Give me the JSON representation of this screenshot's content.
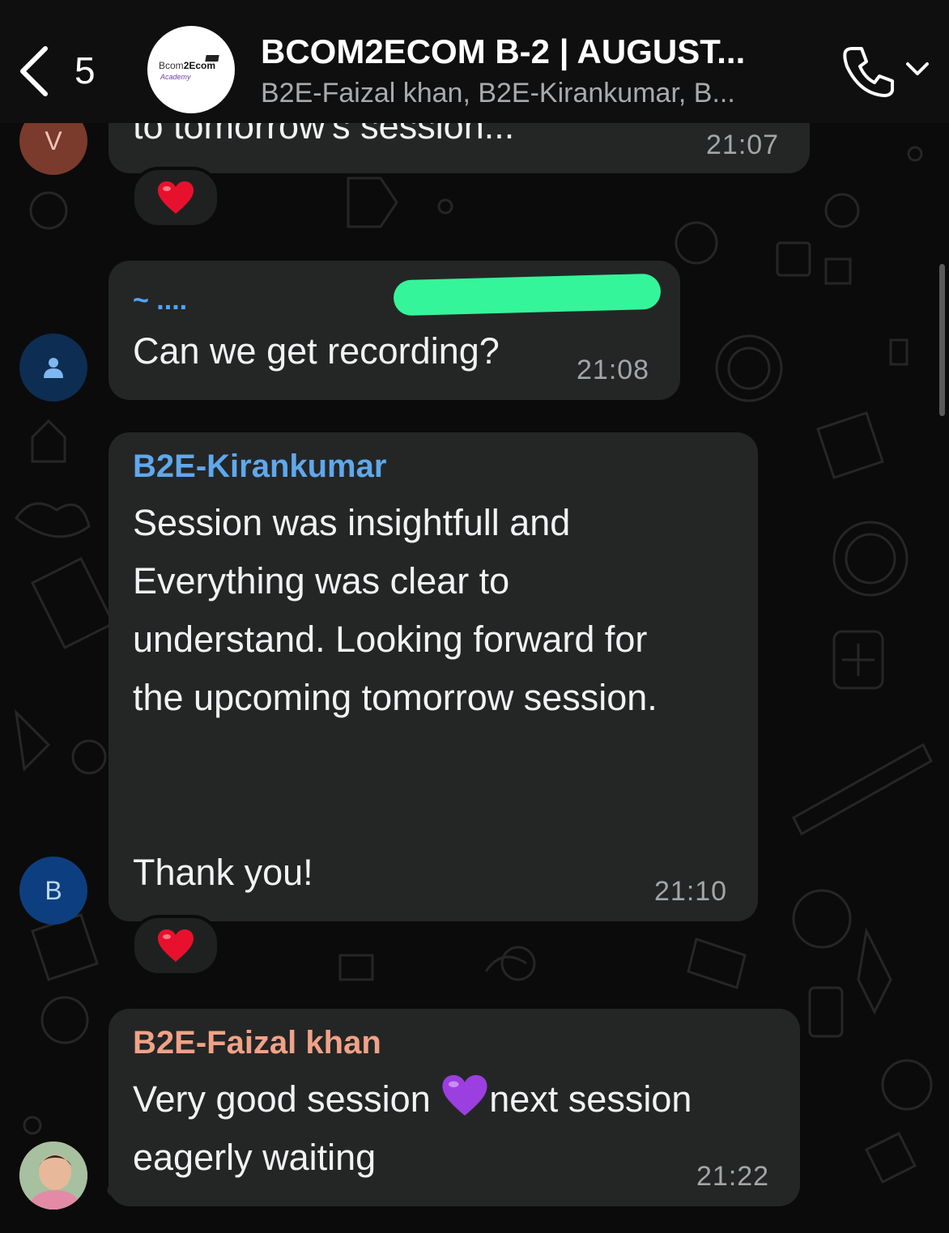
{
  "header": {
    "back_count": "5",
    "title": "BCOM2ECOM B-2 | AUGUST...",
    "subtitle": "B2E-Faizal khan, B2E-Kirankumar, B...",
    "logo_main": "Bcom",
    "logo_bold": "2Ecom",
    "logo_sub": "Academy"
  },
  "colors": {
    "sender_kirankumar": "#5fa8ec",
    "sender_faizal": "#f0a287",
    "sender_unknown": "#4da6ff",
    "bubble": "#242626",
    "redaction": "#35f59a"
  },
  "messages": [
    {
      "id": "m1",
      "avatar_letter": "V",
      "text": "to tomorrow's session...",
      "time": "21:07",
      "reaction": "red-heart"
    },
    {
      "id": "m2",
      "sender": "~ ....",
      "avatar_icon": "person-icon",
      "text": "Can we get recording?",
      "time": "21:08"
    },
    {
      "id": "m3",
      "sender": "B2E-Kirankumar",
      "avatar_letter": "B",
      "text": "Session was insightfull and\nEverything was clear to\nunderstand. Looking forward for\nthe upcoming tomorrow session.\n\n\nThank you!",
      "time": "21:10",
      "reaction": "red-heart"
    },
    {
      "id": "m4",
      "sender": "B2E-Faizal khan",
      "avatar_icon": "photo-avatar",
      "text_before": "Very good session ",
      "emoji": "purple-heart",
      "text_after": "next session",
      "text_line2": "eagerly waiting",
      "time": "21:22"
    }
  ]
}
